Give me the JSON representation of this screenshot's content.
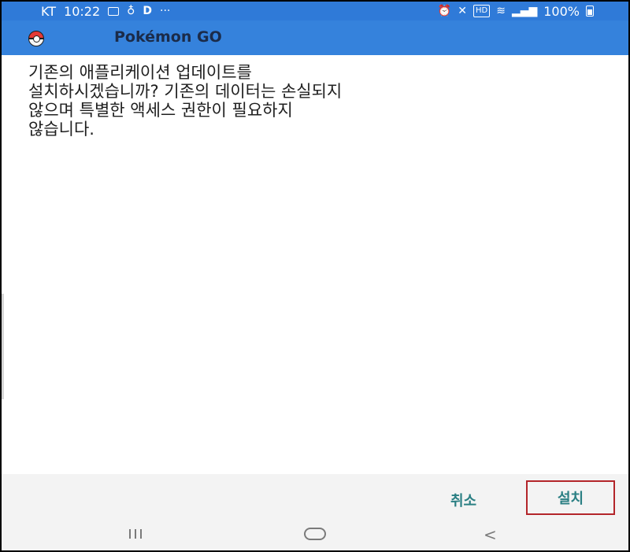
{
  "status_bar": {
    "carrier": "KT",
    "time": "10:22",
    "letter": "D",
    "dots": "···",
    "battery": "100%",
    "icons_left": [
      "gallery-icon",
      "voice-icon",
      "d-app-icon",
      "more-icon"
    ],
    "icons_right": [
      "alarm-icon",
      "mute-icon",
      "hd-icon",
      "wifi-icon",
      "signal-icon",
      "battery-icon"
    ]
  },
  "app_bar": {
    "title": "Pokémon GO",
    "logo_icon": "pokeball-icon"
  },
  "dialog": {
    "message": "기존의 애플리케이션 업데이트를\n설치하시겠습니까? 기존의 데이터는 손실되지\n않으며 특별한 액세스 권한이 필요하지\n않습니다.",
    "cancel_label": "취소",
    "install_label": "설치"
  },
  "nav_bar": {
    "recents_icon": "recents-icon",
    "home_icon": "home-icon",
    "back_icon": "back-icon",
    "back_glyph": "<"
  },
  "colors": {
    "status_bar": "#2f7ad8",
    "app_bar": "#3582dc",
    "button_text": "#2a7f83",
    "highlight_border": "#b3252a"
  }
}
